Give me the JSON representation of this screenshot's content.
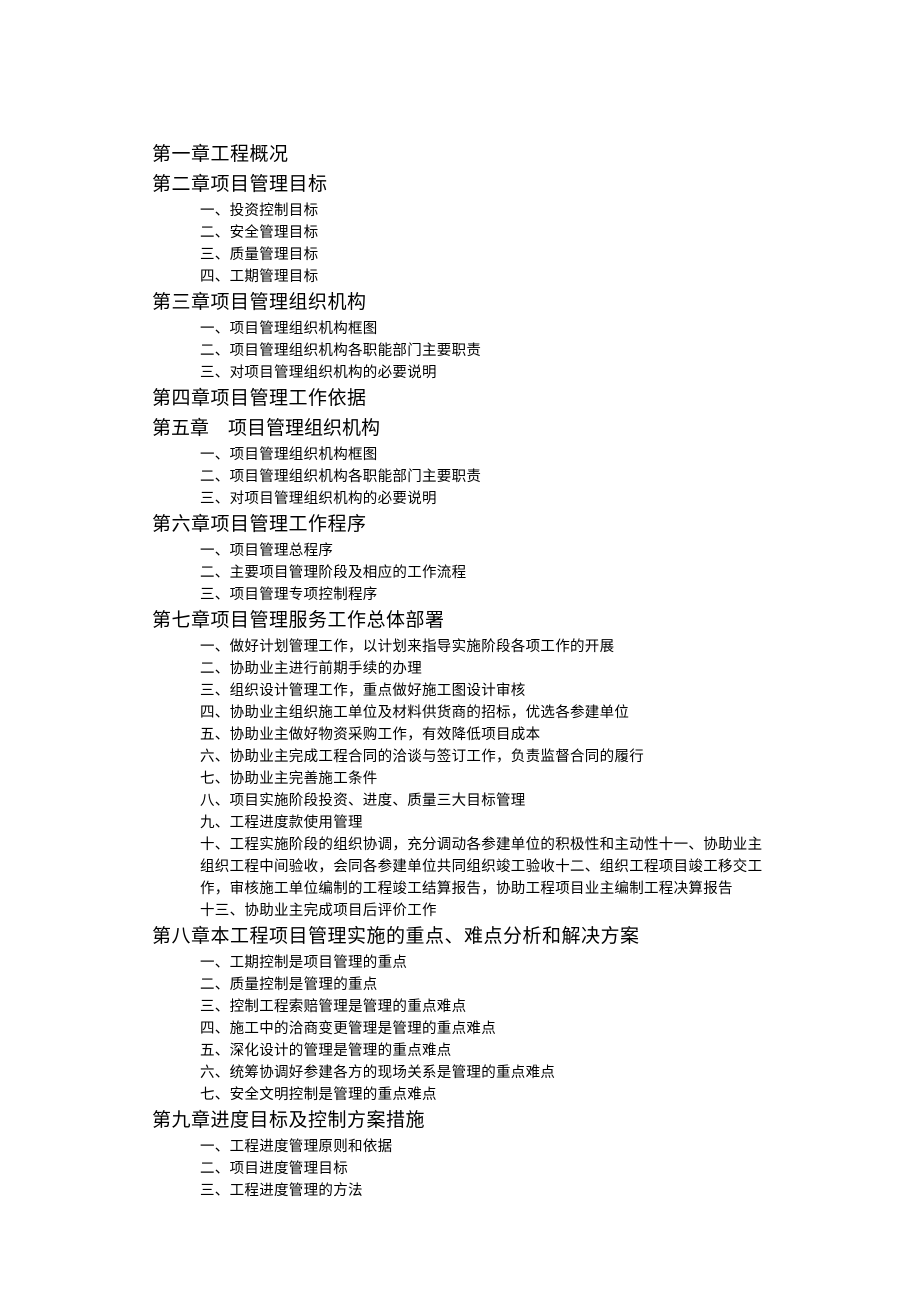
{
  "chapters": [
    {
      "title": "第一章工程概况",
      "items": []
    },
    {
      "title": "第二章项目管理目标",
      "items": [
        "一、投资控制目标",
        "二、安全管理目标",
        "三、质量管理目标",
        "四、工期管理目标"
      ]
    },
    {
      "title": "第三章项目管理组织机构",
      "items": [
        "一、项目管理组织机构框图",
        "二、项目管理组织机构各职能部门主要职责",
        "三、对项目管理组织机构的必要说明"
      ]
    },
    {
      "title": "第四章项目管理工作依据",
      "items": []
    },
    {
      "title": "第五章　项目管理组织机构",
      "items": [
        "一、项目管理组织机构框图",
        "二、项目管理组织机构各职能部门主要职责",
        "三、对项目管理组织机构的必要说明"
      ]
    },
    {
      "title": "第六章项目管理工作程序",
      "items": [
        "一、项目管理总程序",
        "二、主要项目管理阶段及相应的工作流程",
        "三、项目管理专项控制程序"
      ]
    },
    {
      "title": "第七章项目管理服务工作总体部署",
      "items": [
        "一、做好计划管理工作，以计划来指导实施阶段各项工作的开展",
        "二、协助业主进行前期手续的办理",
        "三、组织设计管理工作，重点做好施工图设计审核",
        "四、协助业主组织施工单位及材料供货商的招标，优选各参建单位",
        "五、协助业主做好物资采购工作，有效降低项目成本",
        "六、协助业主完成工程合同的洽谈与签订工作，负责监督合同的履行",
        "七、协助业主完善施工条件",
        "八、项目实施阶段投资、进度、质量三大目标管理",
        "九、工程进度款使用管理",
        "十、工程实施阶段的组织协调，充分调动各参建单位的积极性和主动性十一、协助业主组织工程中间验收，会同各参建单位共同组织竣工验收十二、组织工程项目竣工移交工作，审核施工单位编制的工程竣工结算报告，协助工程项目业主编制工程决算报告",
        "十三、协助业主完成项目后评价工作"
      ]
    },
    {
      "title": "第八章本工程项目管理实施的重点、难点分析和解决方案",
      "items": [
        "一、工期控制是项目管理的重点",
        "二、质量控制是管理的重点",
        "三、控制工程索赔管理是管理的重点难点",
        "四、施工中的洽商变更管理是管理的重点难点",
        "五、深化设计的管理是管理的重点难点",
        "六、统筹协调好参建各方的现场关系是管理的重点难点",
        "七、安全文明控制是管理的重点难点"
      ]
    },
    {
      "title": "第九章进度目标及控制方案措施",
      "items": [
        "一、工程进度管理原则和依据",
        "二、项目进度管理目标",
        "三、工程进度管理的方法"
      ]
    }
  ]
}
